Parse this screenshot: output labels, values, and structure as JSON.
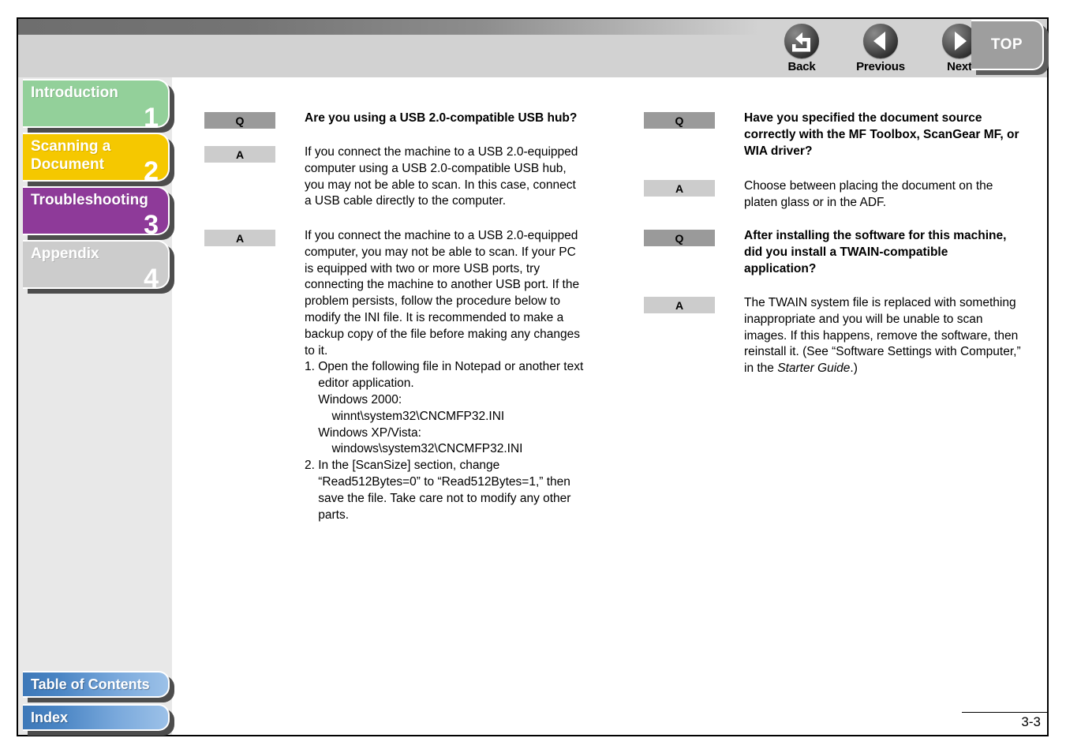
{
  "header": {
    "nav_buttons": [
      {
        "label": "Back",
        "icon": "back-arrow-icon"
      },
      {
        "label": "Previous",
        "icon": "left-triangle-icon"
      },
      {
        "label": "Next",
        "icon": "right-triangle-icon"
      }
    ],
    "top_button": {
      "label": "TOP"
    }
  },
  "sidebar": {
    "tabs": [
      {
        "label": "Introduction",
        "number": "1",
        "color": "#93d09a"
      },
      {
        "label": "Scanning a\nDocument",
        "number": "2",
        "color": "#f5c800"
      },
      {
        "label": "Troubleshooting",
        "number": "3",
        "color": "#8e3a99"
      },
      {
        "label": "Appendix",
        "number": "4",
        "color": "#cccccc"
      }
    ],
    "bottom_buttons": [
      {
        "label": "Table of Contents"
      },
      {
        "label": "Index"
      }
    ]
  },
  "content": {
    "left_column": [
      {
        "tag": "Q",
        "bold": true,
        "text": "Are you using a USB 2.0-compatible USB hub?"
      },
      {
        "tag": "A",
        "bold": false,
        "text": "If you connect the machine to a USB 2.0-equipped\ncomputer using a USB 2.0-compatible USB hub,\nyou may not be able to scan. In this case, connect\na USB cable directly to the computer."
      },
      {
        "tag": "A",
        "bold": false,
        "text": "If you connect the machine to a USB 2.0-equipped\ncomputer, you may not be able to scan. If your PC\nis equipped with two or more USB ports, try\nconnecting the machine to another USB port. If the\nproblem persists, follow the procedure below to\nmodify the INI file. It is recommended to make a\nbackup copy of the file before making any changes\nto it.\n1. Open the following file in Notepad or another text\n    editor application.\n    Windows 2000:\n        winnt\\system32\\CNCMFP32.INI\n    Windows XP/Vista:\n        windows\\system32\\CNCMFP32.INI\n2. In the [ScanSize] section, change\n    “Read512Bytes=0” to “Read512Bytes=1,” then\n    save the file. Take care not to modify any other\n    parts."
      }
    ],
    "right_column": [
      {
        "tag": "Q",
        "bold": true,
        "text": "Have you specified the document source\ncorrectly with the MF Toolbox, ScanGear MF, or\nWIA driver?"
      },
      {
        "tag": "A",
        "bold": false,
        "text": "Choose between placing the document on the\nplaten glass or in the ADF."
      },
      {
        "tag": "Q",
        "bold": true,
        "text": "After installing the software for this machine,\ndid you install a TWAIN-compatible\napplication?"
      },
      {
        "tag": "A",
        "bold": false,
        "text_parts": [
          {
            "t": "The TWAIN system file is replaced with something\ninappropriate and you will be unable to scan\nimages. If this happens, remove the software, then\nreinstall it. (See “Software Settings with Computer,”\nin the ",
            "italic": false
          },
          {
            "t": "Starter Guide",
            "italic": true
          },
          {
            "t": ".)",
            "italic": false
          }
        ]
      }
    ]
  },
  "footer": {
    "page_number": "3-3"
  }
}
